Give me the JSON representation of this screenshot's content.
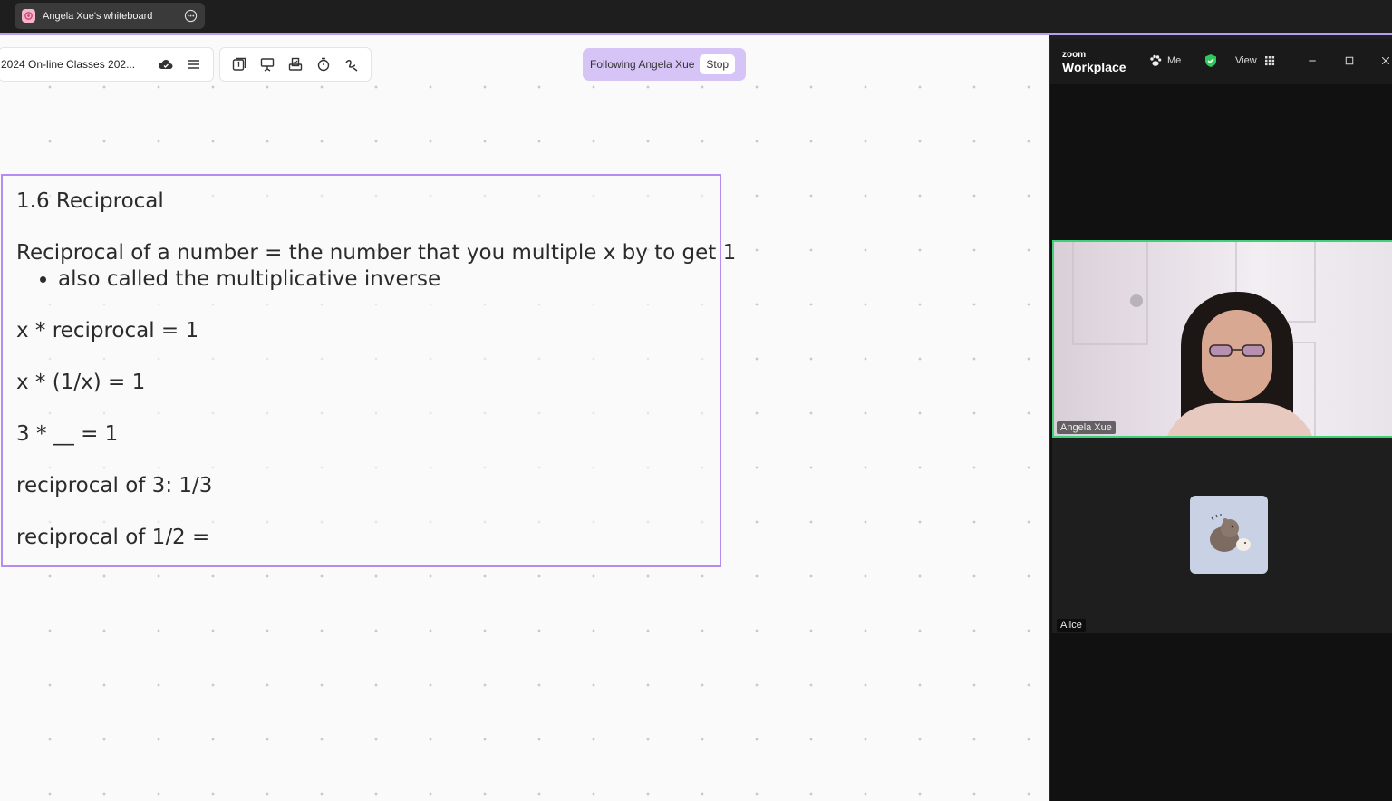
{
  "tab": {
    "title": "Angela Xue's whiteboard"
  },
  "toolbar": {
    "board_name": "2024 On-line Classes 202..."
  },
  "following": {
    "text": "Following Angela Xue",
    "stop_label": "Stop"
  },
  "note": {
    "title": "1.6 Reciprocal",
    "definition": "Reciprocal of a number = the number that you multiple x by to get 1",
    "bullet": "also called the multiplicative inverse",
    "line1": "x * reciprocal = 1",
    "line2": "x * (1/x) = 1",
    "line3": "3 * __ = 1",
    "line4": "reciprocal of 3: 1/3",
    "line5": "reciprocal of 1/2 ="
  },
  "zoom": {
    "brand_small": "zoom",
    "brand_big": "Workplace",
    "menu_label": "Me",
    "view_label": "View",
    "participants": [
      {
        "name": "Angela Xue"
      },
      {
        "name": "Alice"
      }
    ]
  },
  "colors": {
    "accent": "#b48cf2",
    "active_speaker": "#3fd07a",
    "following_bg": "#d6c4f7"
  }
}
